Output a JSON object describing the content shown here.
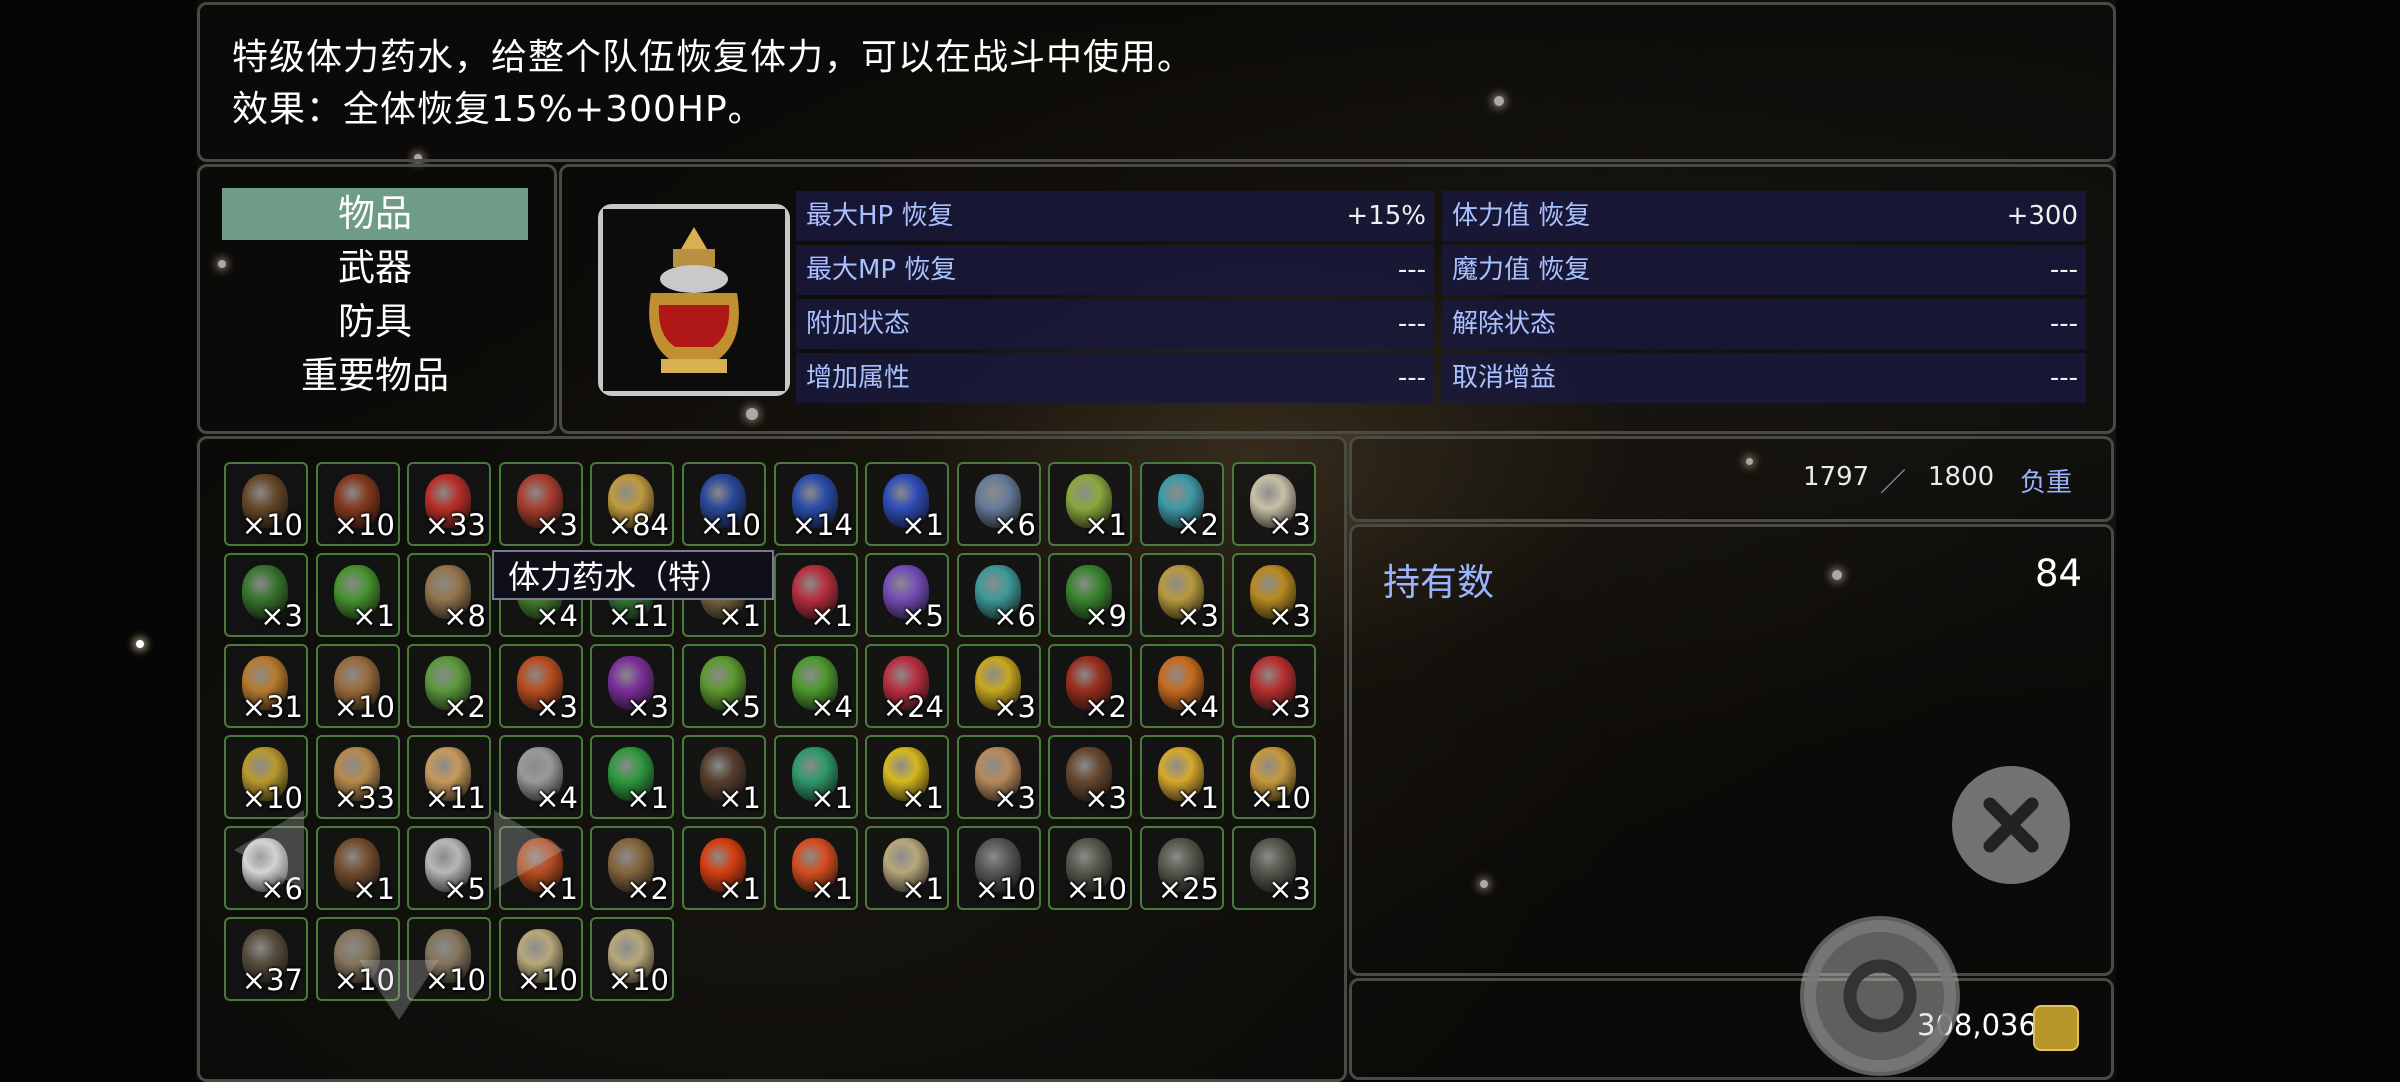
{
  "description": {
    "line1": "特级体力药水，给整个队伍恢复体力，可以在战斗中使用。",
    "line2": "效果：全体恢复15%+300HP。"
  },
  "categories": [
    {
      "label": "物品",
      "selected": true
    },
    {
      "label": "武器",
      "selected": false
    },
    {
      "label": "防具",
      "selected": false
    },
    {
      "label": "重要物品",
      "selected": false
    }
  ],
  "item_icon": "golden-potion-jar-icon",
  "stats": {
    "left": [
      {
        "label": "最大HP 恢复",
        "value": "+15%"
      },
      {
        "label": "最大MP 恢复",
        "value": "---"
      },
      {
        "label": "附加状态",
        "value": "---"
      },
      {
        "label": "增加属性",
        "value": "---"
      }
    ],
    "right": [
      {
        "label": "体力值 恢复",
        "value": "+300"
      },
      {
        "label": "魔力值 恢复",
        "value": "---"
      },
      {
        "label": "解除状态",
        "value": "---"
      },
      {
        "label": "取消增益",
        "value": "---"
      }
    ]
  },
  "weight": {
    "current": "1797",
    "separator": "／",
    "max": "1800",
    "label": "负重"
  },
  "held": {
    "label": "持有数",
    "value": "84"
  },
  "gold": {
    "amount": "308,036",
    "icon": "gold-coin-icon"
  },
  "tooltip": "体力药水（特）",
  "inventory": [
    [
      "×10",
      "×10",
      "×33",
      "×3",
      "×84",
      "×10",
      "×14",
      "×1",
      "×6",
      "×1",
      "×2",
      "×3"
    ],
    [
      "×3",
      "×1",
      "×8",
      "×4",
      "×11",
      "×1",
      "×1",
      "×5",
      "×6",
      "×9",
      "×3",
      "×3"
    ],
    [
      "×31",
      "×10",
      "×2",
      "×3",
      "×3",
      "×5",
      "×4",
      "×24",
      "×3",
      "×2",
      "×4",
      "×3"
    ],
    [
      "×10",
      "×33",
      "×11",
      "×4",
      "×1",
      "×1",
      "×1",
      "×1",
      "×3",
      "×3",
      "×1",
      "×10"
    ],
    [
      "×6",
      "×1",
      "×5",
      "×1",
      "×2",
      "×1",
      "×1",
      "×1",
      "×10",
      "×10",
      "×25",
      "×3"
    ],
    [
      "×37",
      "×10",
      "×10",
      "×10",
      "×10"
    ]
  ],
  "item_colors": [
    [
      "#6b4a2a",
      "#8a3a1e",
      "#c0302a",
      "#b04030",
      "#c8a040",
      "#2a4aa0",
      "#2a50b0",
      "#3050c0",
      "#6a80a0",
      "#90b040",
      "#40a0b0",
      "#d0c8b0"
    ],
    [
      "#3a7a30",
      "#4a9a30",
      "#9a7a50",
      "#4a8a30",
      "#3a7a3a",
      "#7a6a40",
      "#c03040",
      "#7a50c0",
      "#40a0a0",
      "#3a8a30",
      "#c0a040",
      "#c09020"
    ],
    [
      "#c08030",
      "#a07040",
      "#60a040",
      "#c05020",
      "#8030a0",
      "#60a030",
      "#50a030",
      "#c03040",
      "#d0b020",
      "#a03020",
      "#d07020",
      "#c03030"
    ],
    [
      "#c0a030",
      "#c09050",
      "#d0a060",
      "#a0a0a0",
      "#30a040",
      "#5a4030",
      "#30a070",
      "#e0c020",
      "#c09060",
      "#6a4a30",
      "#e0b030",
      "#d0a040"
    ],
    [
      "#e0e0e0",
      "#7a5030",
      "#c0c0c0",
      "#c05020",
      "#8a6a40",
      "#e04010",
      "#e05020",
      "#c0b080",
      "#5a5a5a",
      "#5a5a50",
      "#5a5a50",
      "#5a5a50"
    ],
    [
      "#5a5040",
      "#8a7a60",
      "#8a7a60",
      "#c0b080",
      "#c0b080"
    ]
  ],
  "controls": {
    "close_icon": "close-x-icon",
    "confirm_icon": "confirm-ring-icon"
  }
}
